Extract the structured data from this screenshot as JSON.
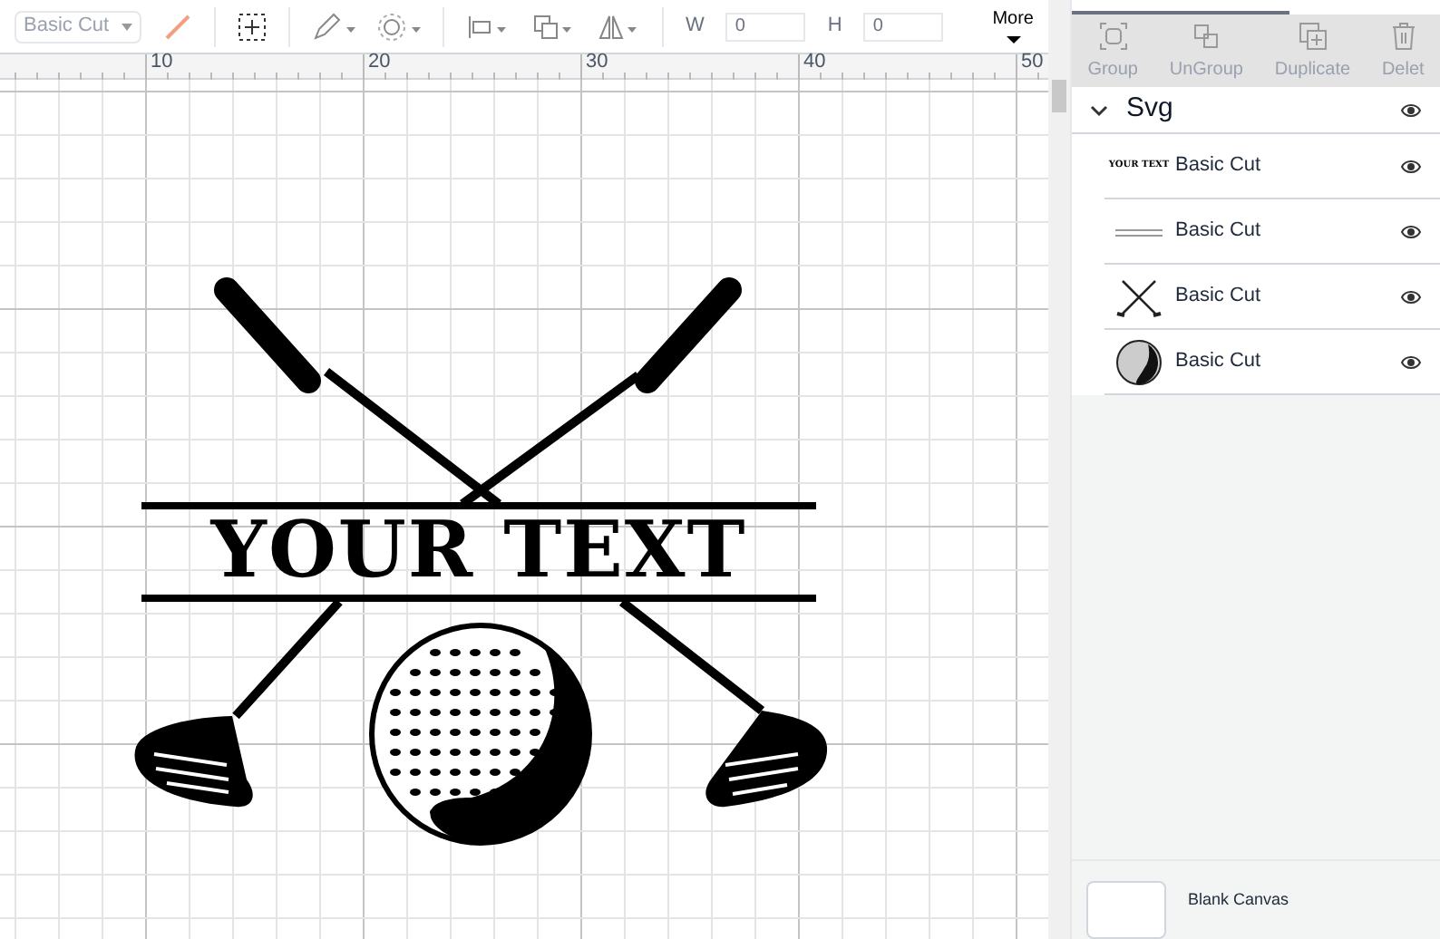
{
  "toolbar": {
    "operation": {
      "value": "Basic Cut",
      "disabled": true
    },
    "size": {
      "w_label": "W",
      "w_value": "0",
      "h_label": "H",
      "h_value": "0"
    },
    "more": {
      "label": "More"
    }
  },
  "ruler": {
    "ticks": [
      "10",
      "20",
      "30",
      "40",
      "50"
    ]
  },
  "design": {
    "text": "YOUR TEXT"
  },
  "layer_actions": [
    {
      "label": "Group",
      "disabled": true
    },
    {
      "label": "UnGroup",
      "disabled": true
    },
    {
      "label": "Duplicate",
      "disabled": true
    },
    {
      "label": "Delet",
      "disabled": true
    }
  ],
  "layers": {
    "label": "Svg",
    "expanded": true,
    "visible": true,
    "children": [
      {
        "kind": "text",
        "thumbnail_text": "YOUR TEXT",
        "label": "Basic Cut",
        "visible": true
      },
      {
        "kind": "lines",
        "label": "Basic Cut",
        "visible": true
      },
      {
        "kind": "clubs",
        "label": "Basic Cut",
        "visible": true
      },
      {
        "kind": "ball",
        "label": "Basic Cut",
        "visible": true
      }
    ]
  },
  "blank_canvas": {
    "label": "Blank Canvas"
  }
}
